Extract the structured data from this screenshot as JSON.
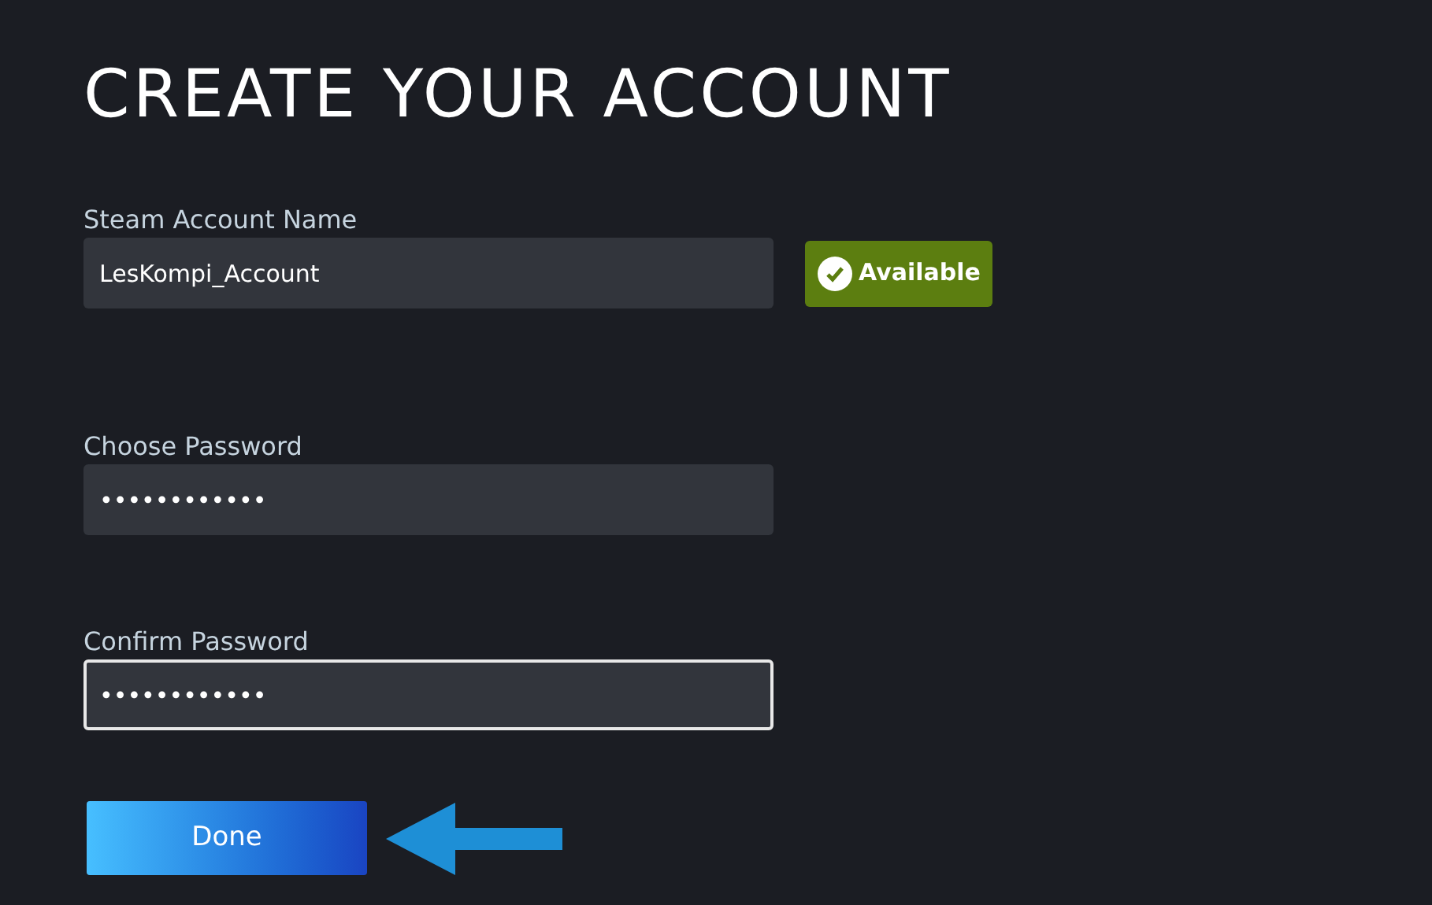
{
  "title": "CREATE YOUR ACCOUNT",
  "fields": [
    {
      "label": "Steam Account Name",
      "value": "LesKompi_Account",
      "focused": false,
      "status": "Available"
    },
    {
      "label": "Choose Password",
      "value": "••••••••••••",
      "focused": false
    },
    {
      "label": "Confirm Password",
      "value": "••••••••••••",
      "focused": true
    }
  ],
  "done_button": "Done"
}
